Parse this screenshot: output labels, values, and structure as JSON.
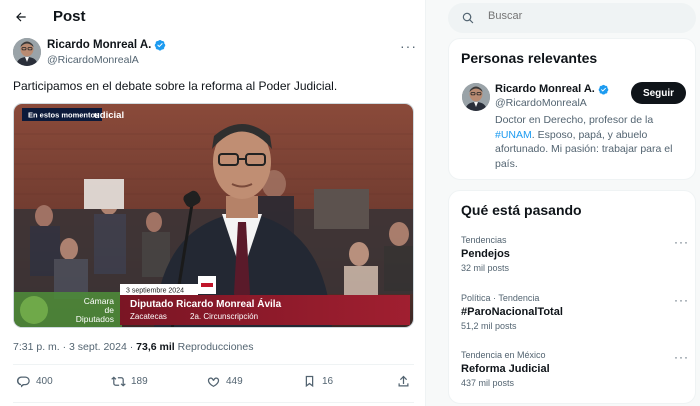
{
  "header": {
    "title": "Post"
  },
  "tweet": {
    "author_name": "Ricardo Monreal A.",
    "author_handle": "@RicardoMonrealA",
    "text": "Participamos en el debate sobre la reforma al Poder Judicial.",
    "timestamp": "7:31 p. m. · 3 sept. 2024 · ",
    "views": "73,6 mil",
    "views_label": " Reproducciones",
    "media": {
      "live_badge": "En estos momentos",
      "top_banner": "udicial",
      "caption_date": "3 septiembre 2024",
      "caption_name": "Diputado Ricardo Monreal Ávila",
      "caption_state": "Zacatecas",
      "caption_district": "2a. Circunscripción",
      "channel_line1": "Cámara",
      "channel_line2": "de",
      "channel_line3": "Diputados"
    },
    "actions": {
      "replies": "400",
      "reposts": "189",
      "likes": "449",
      "bookmarks": "16"
    }
  },
  "sidebar": {
    "search_placeholder": "Buscar",
    "relevant": {
      "title": "Personas relevantes",
      "name": "Ricardo Monreal A.",
      "handle": "@RicardoMonrealA",
      "follow_label": "Seguir",
      "bio_before": "Doctor en Derecho, profesor de la ",
      "bio_tag": "#UNAM",
      "bio_after": ". Esposo, papá, y abuelo afortunado. Mi pasión: trabajar para el país."
    },
    "trending": {
      "title": "Qué está pasando",
      "items": [
        {
          "meta": "Tendencias",
          "name": "Pendejos",
          "posts": "32 mil posts"
        },
        {
          "meta": "Política · Tendencia",
          "name": "#ParoNacionalTotal",
          "posts": "51,2 mil posts"
        },
        {
          "meta": "Tendencia en México",
          "name": "Reforma Judicial",
          "posts": "437 mil posts"
        }
      ]
    }
  },
  "colors": {
    "accent": "#1d9bf0",
    "verified": "#1d9bf0",
    "text": "#0f1419",
    "muted": "#536471",
    "caption_red": "#8e1b2a"
  }
}
